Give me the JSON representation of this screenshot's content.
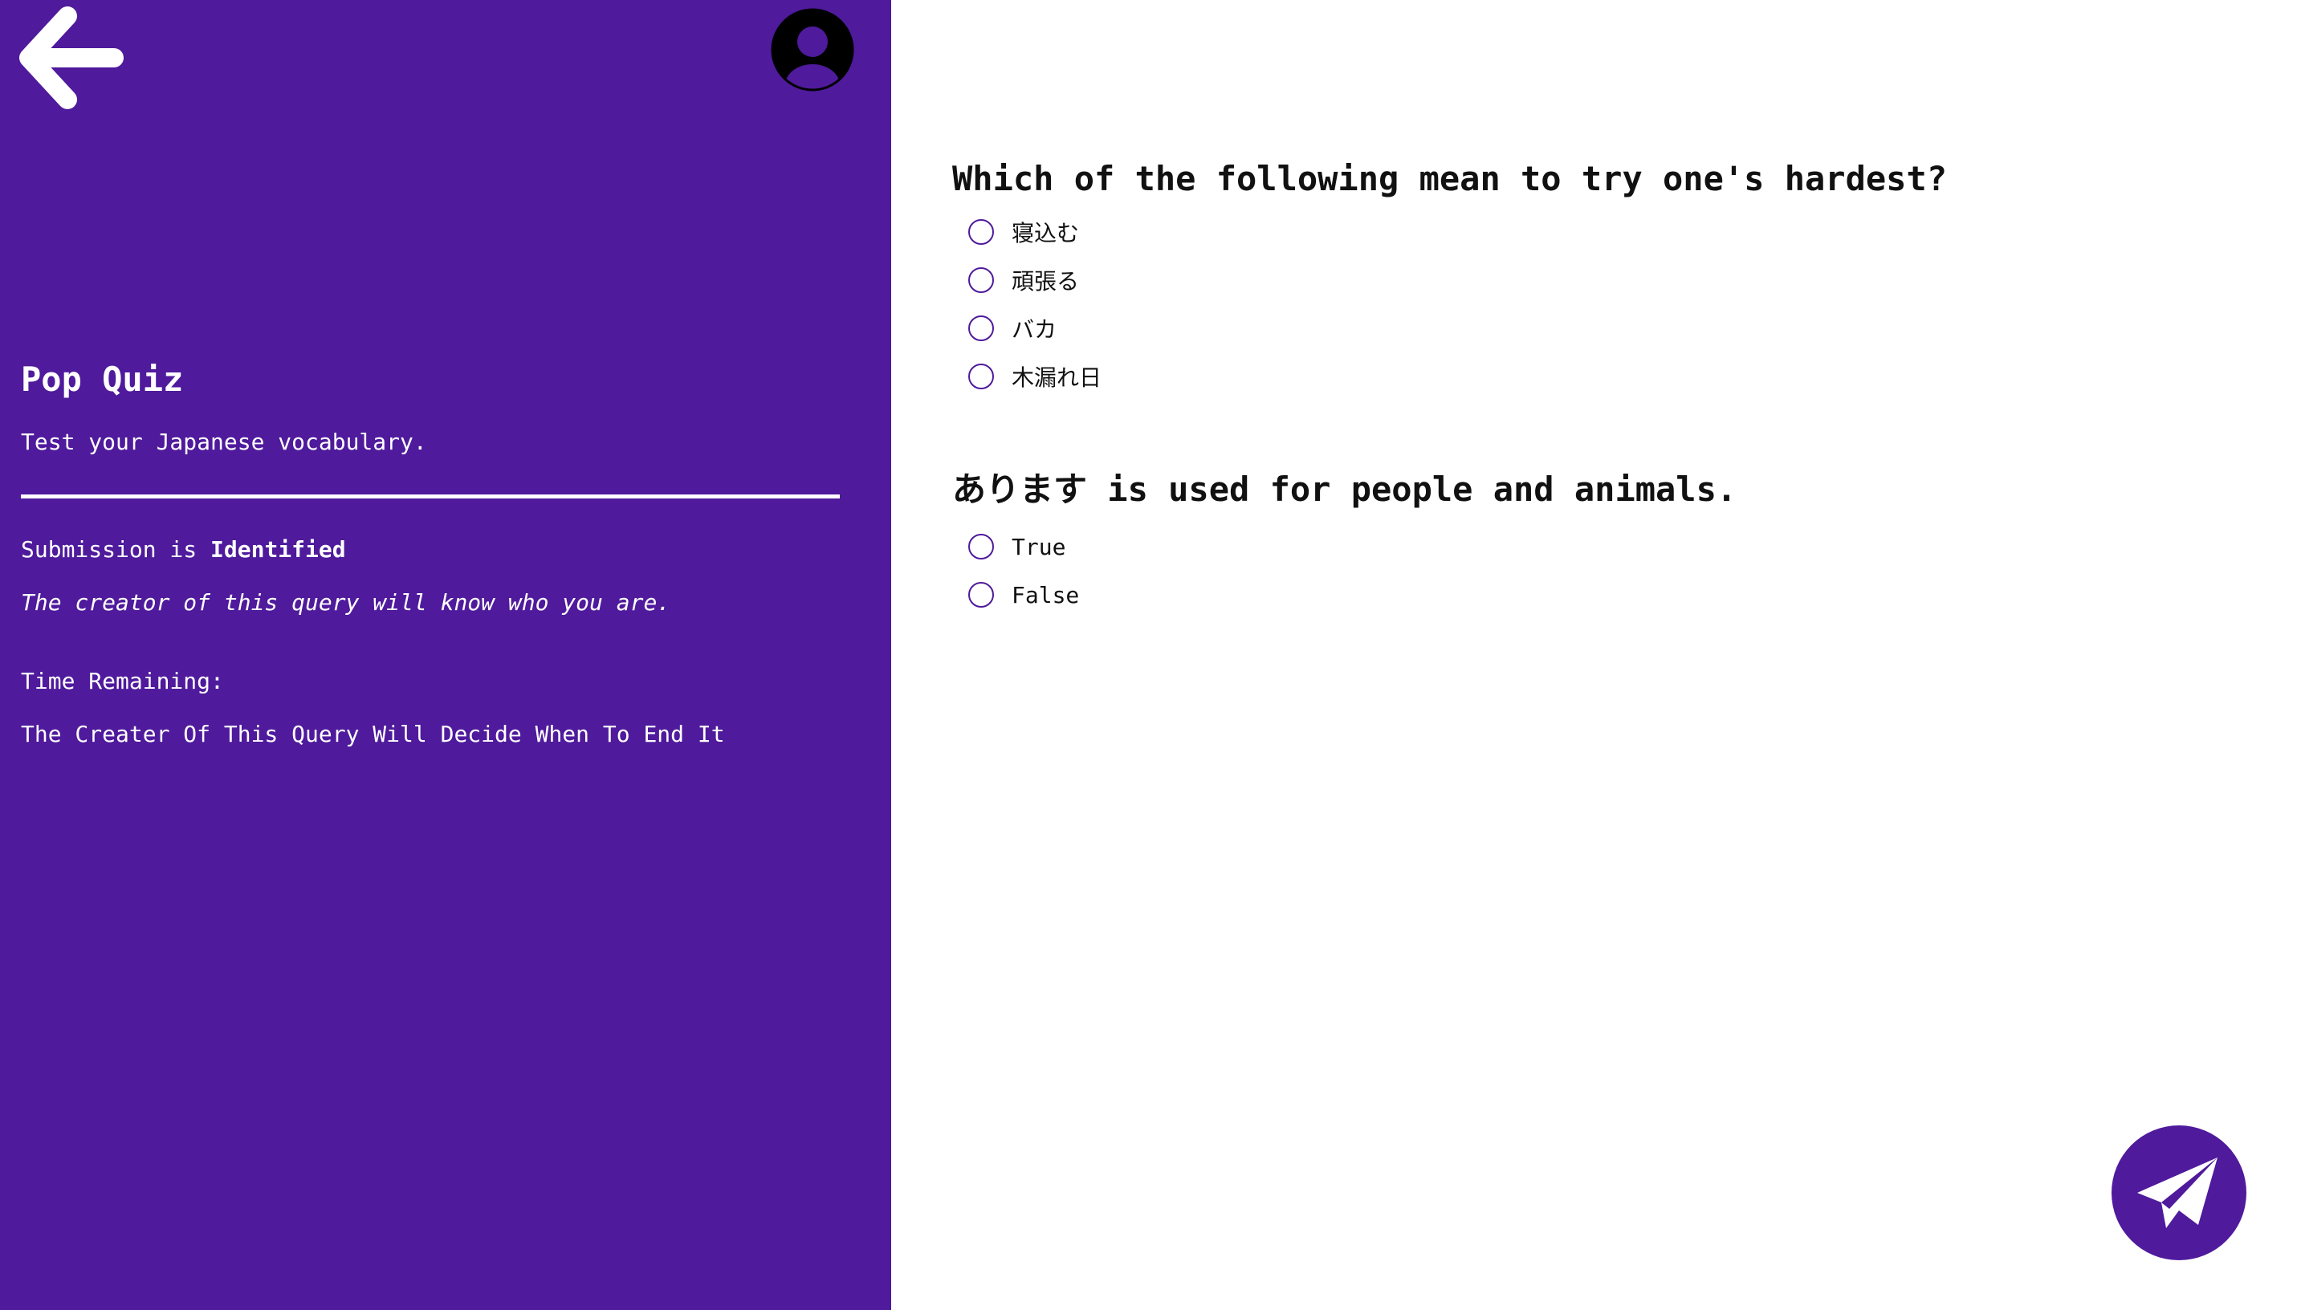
{
  "header": {
    "back_icon": "arrow-left-icon",
    "avatar_icon": "user-avatar-icon"
  },
  "sidebar": {
    "title": "Pop Quiz",
    "description": "Test your Japanese vocabulary.",
    "submission_prefix": "Submission is",
    "submission_mode": "Identified",
    "creator_note": "The creator of this query will know who you are.",
    "time_label": "Time Remaining:",
    "time_value": "The Creater Of This Query Will Decide When To End It"
  },
  "questions": [
    {
      "text": "Which of the following mean to try one's hardest?",
      "options": [
        "寝込む",
        "頑張る",
        "バカ",
        "木漏れ日"
      ]
    },
    {
      "text": "あります is used for people and animals.",
      "options": [
        "True",
        "False"
      ]
    }
  ],
  "actions": {
    "send_icon": "paper-plane-icon"
  },
  "colors": {
    "accent": "#4f1a9c",
    "background": "#ffffff",
    "text": "#111111"
  }
}
